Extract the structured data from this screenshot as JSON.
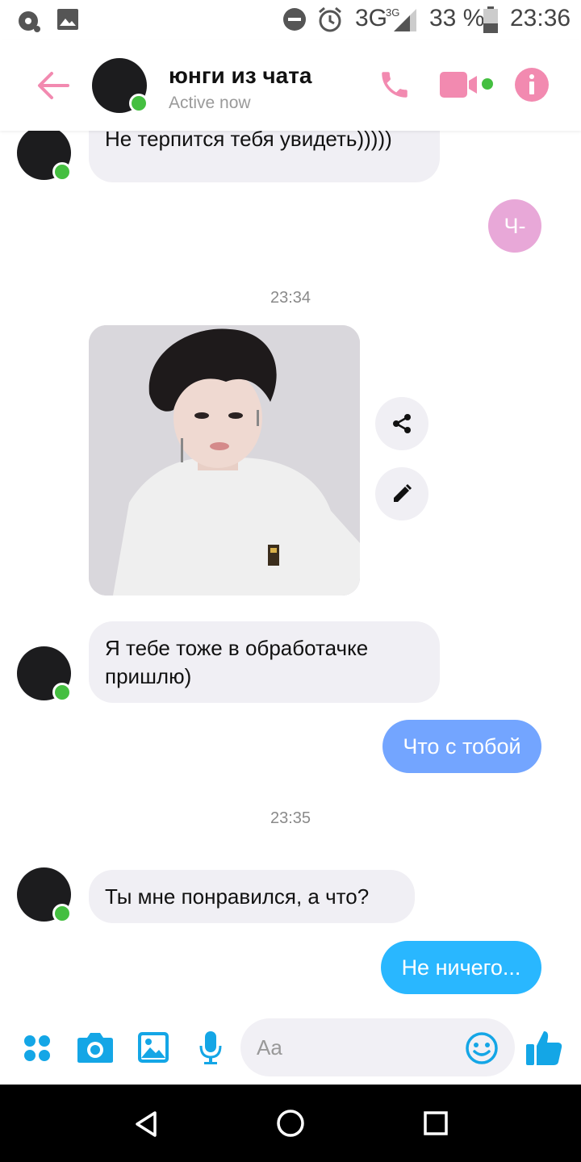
{
  "status_bar": {
    "network": "3G",
    "network_small": "3G",
    "battery": "33 %",
    "time": "23:36"
  },
  "header": {
    "contact_name": "юнги из чата",
    "contact_status": "Active now"
  },
  "colors": {
    "accent_pink": "#f28ab0",
    "outgoing_blue_light": "#73a5ff",
    "outgoing_blue": "#29b7ff",
    "incoming_bg": "#f0eff4",
    "composer_blue": "#14a6e6",
    "online_green": "#44bf40"
  },
  "messages": [
    {
      "direction": "in",
      "text": "Не терпится тебя увидеть)))))"
    },
    {
      "direction": "out",
      "text": "Ч-"
    },
    {
      "type": "timestamp",
      "text": "23:34"
    },
    {
      "direction": "in",
      "type": "photo",
      "description_icon": "photo"
    },
    {
      "direction": "in",
      "text": "Я тебе тоже в обработачке пришлю)"
    },
    {
      "direction": "out",
      "text": "Что с тобой"
    },
    {
      "type": "timestamp",
      "text": "23:35"
    },
    {
      "direction": "in",
      "text": "Ты мне понравился, а что?"
    },
    {
      "direction": "out",
      "text": "Не ничего..."
    }
  ],
  "composer": {
    "placeholder": "Aa"
  },
  "icons": [
    "back-arrow-icon",
    "phone-icon",
    "video-camera-icon",
    "info-icon",
    "share-icon",
    "edit-pencil-icon",
    "apps-grid-icon",
    "camera-icon",
    "gallery-icon",
    "microphone-icon",
    "emoji-icon",
    "thumbs-up-icon",
    "nav-back-icon",
    "nav-home-icon",
    "nav-recents-icon"
  ]
}
